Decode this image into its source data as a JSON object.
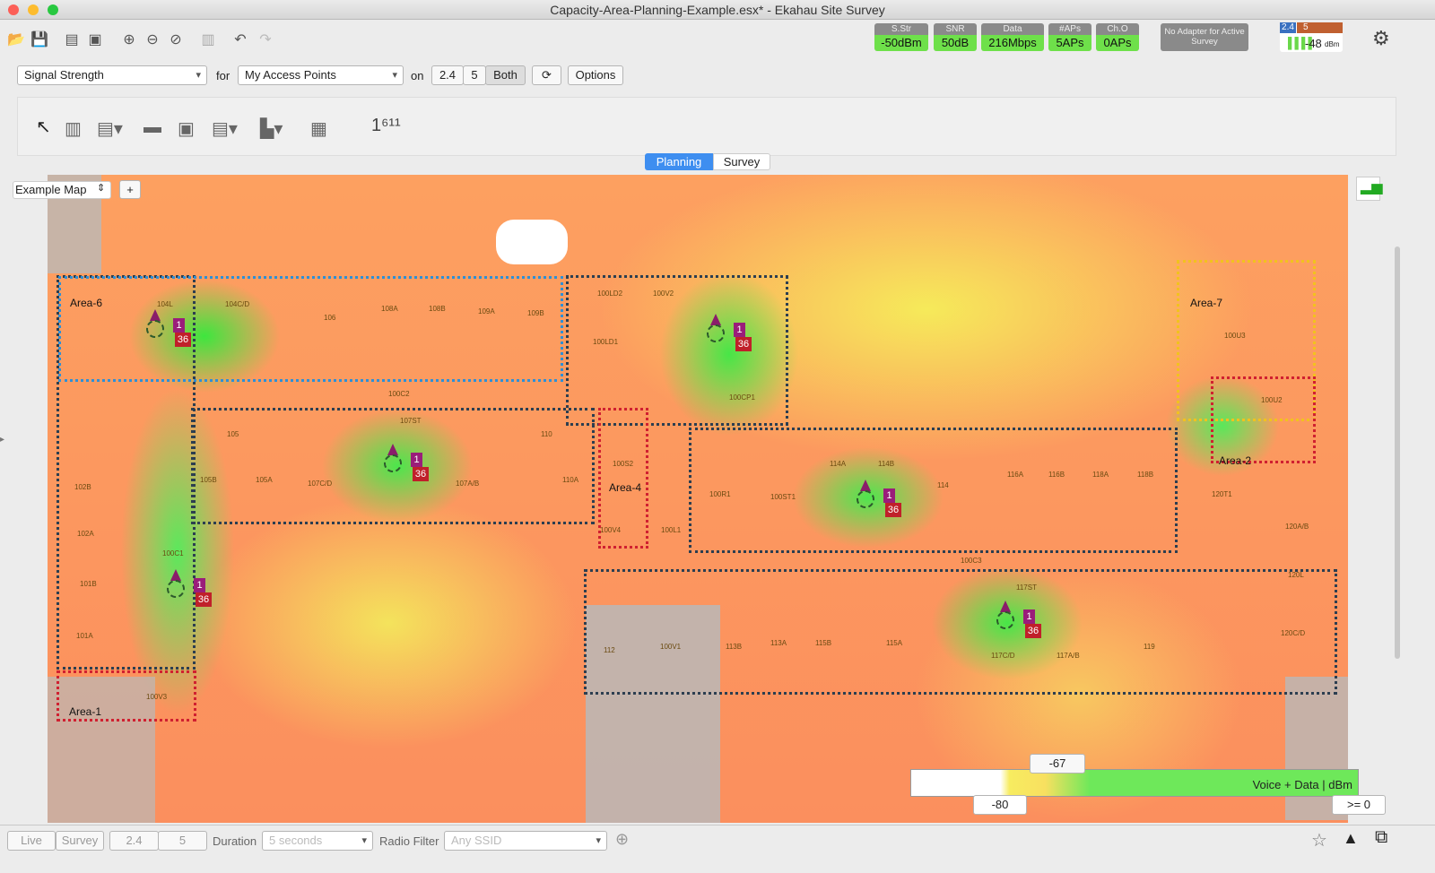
{
  "window": {
    "title": "Capacity-Area-Planning-Example.esx* - Ekahau Site Survey"
  },
  "status": [
    {
      "label": "S.Str",
      "value": "-50dBm"
    },
    {
      "label": "SNR",
      "value": "50dB"
    },
    {
      "label": "Data",
      "value": "216Mbps"
    },
    {
      "label": "#APs",
      "value": "5APs"
    },
    {
      "label": "Ch.O",
      "value": "0APs"
    }
  ],
  "adapter": {
    "text": "No Adapter for Active Survey",
    "band24": "2.4",
    "band5": "5",
    "signal": "-48",
    "unit": "dBm"
  },
  "filters": {
    "visualization": "Signal Strength",
    "for_label": "for",
    "source": "My Access Points",
    "on_label": "on",
    "band_24": "2.4",
    "band_5": "5",
    "band_both": "Both",
    "options": "Options"
  },
  "mode_tabs": {
    "planning": "Planning",
    "survey": "Survey"
  },
  "map": {
    "name": "Example Map",
    "add": "+",
    "areas": [
      "Area-6",
      "Area-7",
      "Area-2",
      "Area-4",
      "Area-1"
    ],
    "aps": [
      {
        "n": "1",
        "ch": "36"
      },
      {
        "n": "1",
        "ch": "36"
      },
      {
        "n": "1",
        "ch": "36"
      },
      {
        "n": "1",
        "ch": "36"
      },
      {
        "n": "1",
        "ch": "36"
      },
      {
        "n": "1",
        "ch": "36"
      }
    ],
    "rooms": [
      "104L",
      "104C/D",
      "106",
      "108A",
      "108B",
      "109A",
      "109B",
      "100LD2",
      "100V2",
      "100LD1",
      "100CP1",
      "100U3",
      "100U2",
      "105",
      "107ST",
      "107C/D",
      "107A/B",
      "110",
      "110A",
      "105A",
      "105B",
      "102B",
      "102A",
      "101B",
      "101A",
      "100C1",
      "100V3",
      "100C2",
      "100S2",
      "100V4",
      "100L1",
      "100R1",
      "100ST1",
      "114A",
      "114B",
      "114",
      "116A",
      "116B",
      "118A",
      "118B",
      "120T1",
      "120A/B",
      "120L",
      "120C/D",
      "119",
      "117ST",
      "117C/D",
      "117A/B",
      "115A",
      "115B",
      "113A",
      "113B",
      "112",
      "100V1",
      "100C3"
    ]
  },
  "legend": {
    "title": "Voice + Data | dBm",
    "mid": "-67",
    "low": "-80",
    "high": ">= 0",
    "colors": [
      "#ffffff",
      "#f6ea5a",
      "#6ee85a"
    ]
  },
  "bottom": {
    "live": "Live",
    "survey": "Survey",
    "b24": "2.4",
    "b5": "5",
    "duration_label": "Duration",
    "duration": "5 seconds",
    "radio_label": "Radio Filter",
    "radio": "Any SSID"
  }
}
